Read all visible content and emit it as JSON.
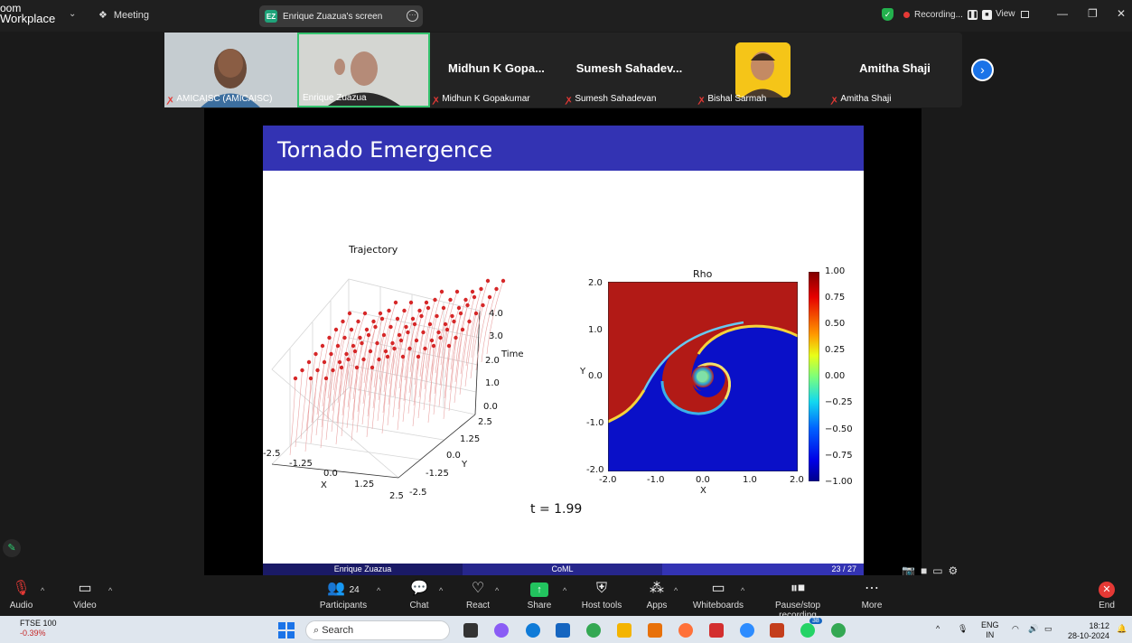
{
  "topbar": {
    "brand_line1": "oom",
    "brand_line2": "Workplace",
    "meeting_label": "Meeting",
    "screen_badge": "EZ",
    "screen_label": "Enrique Zuazua's screen",
    "recording_label": "Recording...",
    "view_label": "View"
  },
  "participants": [
    {
      "label": "AMICAISC (AMICAISC)",
      "display": ""
    },
    {
      "label": "Enrique Zuazua",
      "display": ""
    },
    {
      "label": "Midhun K Gopakumar",
      "display": "Midhun K Gopa..."
    },
    {
      "label": "Sumesh Sahadevan",
      "display": "Sumesh Sahadev..."
    },
    {
      "label": "Bishal Sarmah",
      "display": ""
    },
    {
      "label": "Amitha Shaji",
      "display": "Amitha Shaji"
    }
  ],
  "slide": {
    "title": "Tornado Emergence",
    "footer_left": "Enrique Zuazua",
    "footer_center": "CoML",
    "footer_right": "23 / 27",
    "time_label": "t = 1.99",
    "trajectory_title": "Trajectory",
    "rho_title": "Rho",
    "traj_axes": {
      "x_label": "X",
      "y_label": "Y",
      "z_label": "Time",
      "x_ticks": [
        "-2.5",
        "-1.25",
        "0.0",
        "1.25",
        "2.5"
      ],
      "y_ticks": [
        "2.5",
        "1.25",
        "0.0",
        "-1.25",
        "-2.5"
      ],
      "z_ticks": [
        "4.0",
        "3.0",
        "2.0",
        "1.0",
        "0.0"
      ]
    },
    "rho_axes": {
      "x_label": "X",
      "y_label": "Y",
      "x_ticks": [
        "-2.0",
        "-1.0",
        "0.0",
        "1.0",
        "2.0"
      ],
      "y_ticks": [
        "2.0",
        "1.0",
        "0.0",
        "-1.0",
        "-2.0"
      ],
      "colorbar_ticks": [
        "1.00",
        "0.75",
        "0.50",
        "0.25",
        "0.00",
        "−0.25",
        "−0.50",
        "−0.75",
        "−1.00"
      ]
    }
  },
  "toolbar": {
    "audio": "Audio",
    "video": "Video",
    "participants": "Participants",
    "participants_count": "24",
    "chat": "Chat",
    "react": "React",
    "share": "Share",
    "host_tools": "Host tools",
    "apps": "Apps",
    "whiteboards": "Whiteboards",
    "pause_stop": "Pause/stop recording",
    "more": "More",
    "end": "End"
  },
  "taskbar": {
    "ticker_name": "FTSE 100",
    "ticker_change": "-0.39%",
    "search_placeholder": "Search",
    "badge_count": "38",
    "lang_line1": "ENG",
    "lang_line2": "IN",
    "time": "18:12",
    "date": "28-10-2024"
  },
  "colors": {
    "slide_header": "#3333b3",
    "recording_dot": "#e53935",
    "share_green": "#22c35e",
    "accent_blue": "#1a73e8"
  }
}
